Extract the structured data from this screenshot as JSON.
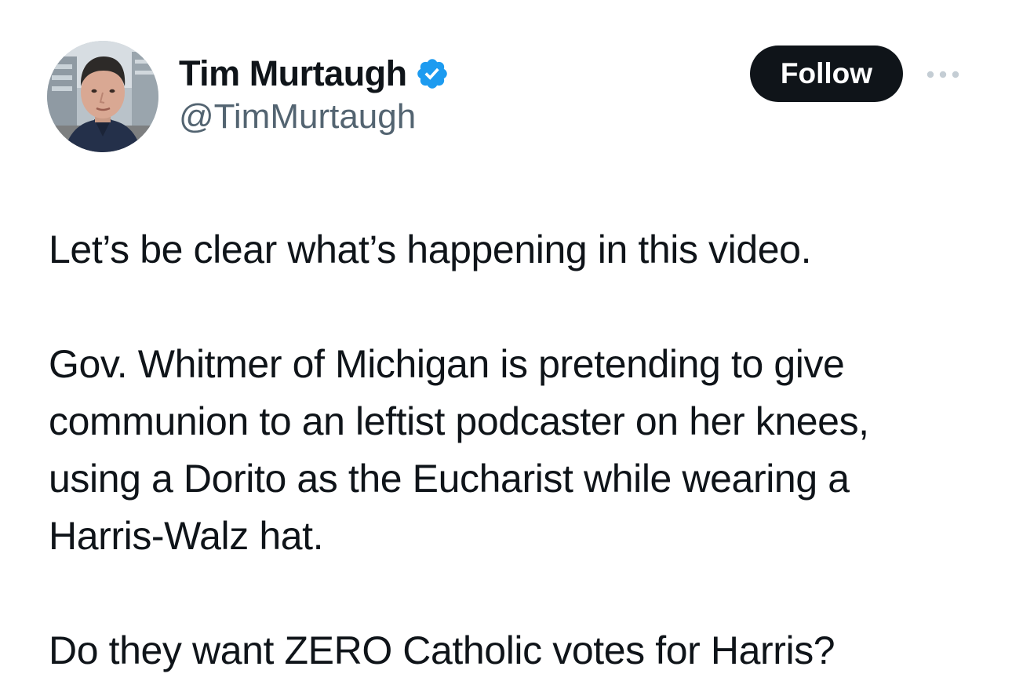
{
  "author": {
    "display_name": "Tim Murtaugh",
    "handle": "@TimMurtaugh",
    "verified": true,
    "avatar_icon": "profile-photo"
  },
  "actions": {
    "follow_label": "Follow",
    "more_icon": "more-horizontal-icon"
  },
  "tweet": {
    "paragraphs": [
      "Let’s be clear what’s happening in this video.",
      "Gov. Whitmer of Michigan is pretending to give\ncommunion to an leftist podcaster on her knees,\nusing a Dorito as the Eucharist while wearing a\nHarris-Walz hat.",
      "Do they want ZERO Catholic votes for Harris?"
    ]
  },
  "colors": {
    "text_primary": "#0f1419",
    "text_secondary": "#536471",
    "verified_blue": "#1d9bf0",
    "follow_bg": "#0f1419",
    "follow_text": "#ffffff"
  }
}
